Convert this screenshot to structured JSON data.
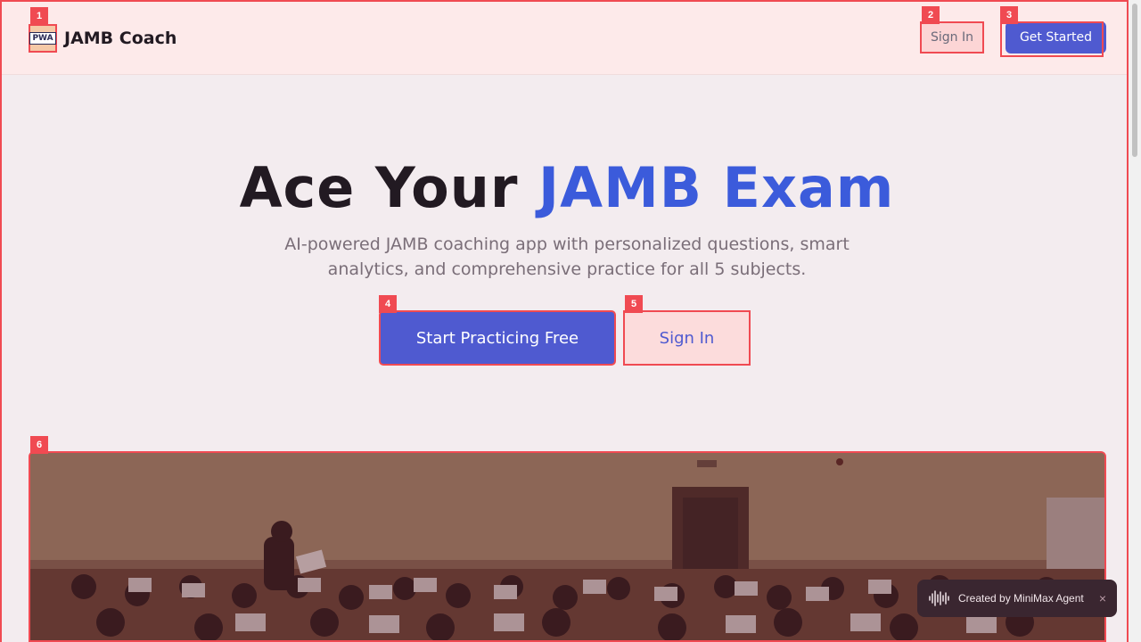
{
  "header": {
    "brand_name": "JAMB Coach",
    "logo_text": "PWA",
    "signin_label": "Sign In",
    "get_started_label": "Get Started"
  },
  "hero": {
    "title_part1": "Ace Your ",
    "title_accent": "JAMB Exam",
    "subtitle": "AI-powered JAMB coaching app with personalized questions, smart analytics, and comprehensive practice for all 5 subjects.",
    "primary_cta": "Start Practicing Free",
    "secondary_cta": "Sign In"
  },
  "badges": [
    "1",
    "2",
    "3",
    "4",
    "5",
    "6"
  ],
  "toast": {
    "label": "Created by MiniMax Agent",
    "close": "×"
  },
  "colors": {
    "accent": "#3b5bdb",
    "button": "#4f5ad0",
    "highlight": "#f04a52",
    "header_bg": "#fdeaea"
  },
  "icons": {
    "logo": "pwa-logo-icon",
    "toast_wave": "sound-wave-icon",
    "toast_close": "close-icon"
  }
}
